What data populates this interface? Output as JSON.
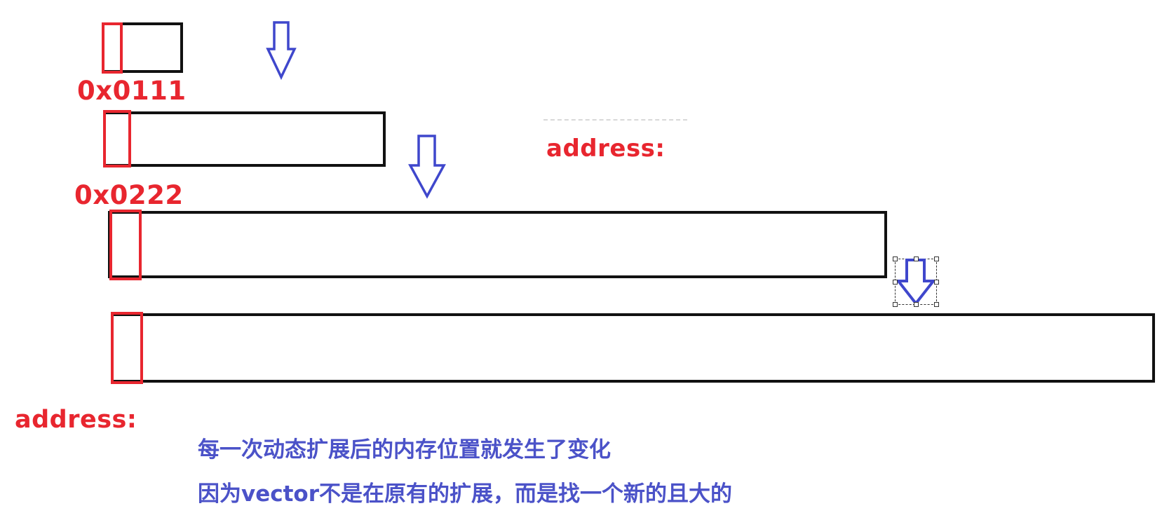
{
  "address_labels": {
    "first": "0x0111",
    "second": "0x0222",
    "right": "address:",
    "bottom": "address:"
  },
  "captions": [
    "每一次动态扩展后的内存位置就发生了变化",
    "因为vector不是在原有的扩展，而是找一个新的且大的"
  ],
  "colors": {
    "block_border": "#111111",
    "marker": "#e8262f",
    "arrow": "#3f47cc",
    "caption": "#4b52c8"
  }
}
